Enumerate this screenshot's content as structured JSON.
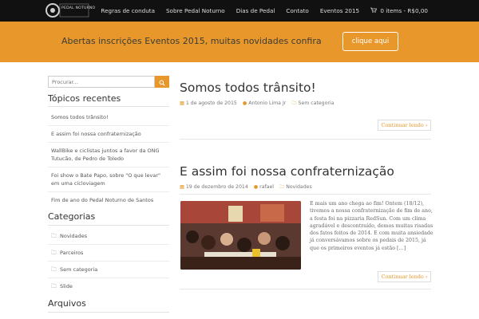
{
  "header": {
    "logo_text": "PEDAL NOTURNO",
    "nav": [
      "Regras de conduta",
      "Sobre Pedal Noturno",
      "Dias de Pedal",
      "Contato",
      "Eventos 2015"
    ],
    "cart_label": "0 items - R$0,00",
    "cart_icon": "cart-icon"
  },
  "banner": {
    "text": "Abertas inscrições Eventos 2015, muitas novidades confira",
    "button_label": "clique aqui"
  },
  "sidebar": {
    "search_placeholder": "Procurar...",
    "recent_title": "Tópicos recentes",
    "recent": [
      "Somos todos trânsito!",
      "E assim foi nossa confraternização",
      "WallBike e ciclistas juntos a favor da ONG Tutucão, de Pedro de Toledo",
      "Foi show o Bate Papo, sobre \"O que levar\" em uma cicloviagem",
      "Fim de ano do Pedal Noturno de Santos"
    ],
    "categories_title": "Categorias",
    "categories": [
      "Novidades",
      "Parceiros",
      "Sem categoria",
      "Slide"
    ],
    "archives_title": "Arquivos"
  },
  "posts": [
    {
      "title": "Somos todos trânsito!",
      "date": "1 de agosto de 2015",
      "author": "Antonio Lima Jr",
      "category": "Sem categoria",
      "more_label": "Continuar lendo"
    },
    {
      "title": "E assim foi nossa confraternização",
      "date": "19 de dezembro de 2014",
      "author": "rafael",
      "category": "Novidades",
      "excerpt": "E mais um ano chega ao fim! Ontem (18/12), tivemos a nossa confraternização de fim de ano, a festa foi na pizzaria RedSun. Com um clima agradável e descontraído, demos muitas risadas dos fatos  feitos de 2014. E com muita ansiedade já conversávamos sobre os pedais de 2015, já que os primeiros eventos já estão […]",
      "more_label": "Continuar lendo"
    }
  ],
  "colors": {
    "accent": "#e8982a",
    "topbar": "#111111"
  }
}
